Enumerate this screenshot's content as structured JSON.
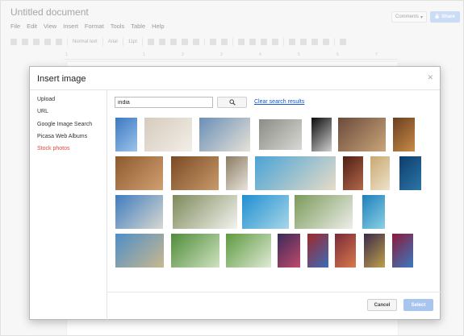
{
  "doc": {
    "title": "Untitled document",
    "menu": [
      "File",
      "Edit",
      "View",
      "Insert",
      "Format",
      "Tools",
      "Table",
      "Help"
    ],
    "comments_label": "Comments",
    "share_label": "Share",
    "toolbar": {
      "style": "Normal text",
      "font": "Arial",
      "size": "11pt"
    },
    "ruler_ticks": [
      "1",
      "1",
      "2",
      "3",
      "4",
      "5",
      "6",
      "7"
    ]
  },
  "dialog": {
    "title": "Insert image",
    "close_icon": "close-icon",
    "nav": [
      "Upload",
      "URL",
      "Google Image Search",
      "Picasa Web Albums",
      "Stock photos"
    ],
    "active_nav": "Stock photos",
    "active_color": "#dd4b39",
    "search_value": "india",
    "search_icon": "search-icon",
    "clear_label": "Clear search results",
    "cancel_label": "Cancel",
    "select_label": "Select",
    "accent": "#a8c5f0",
    "link_color": "#1155cc"
  },
  "thumbnails": [
    {
      "name": "blue-sky-water",
      "colors": [
        "#3b78c2",
        "#9cc4ea"
      ]
    },
    {
      "name": "white-room",
      "colors": [
        "#d6cbbd",
        "#f2eee8"
      ]
    },
    {
      "name": "taj-mahal",
      "colors": [
        "#6a8fb8",
        "#e6e1d6"
      ]
    },
    {
      "name": "elephant",
      "colors": [
        "#8c8c86",
        "#d8d8d4"
      ]
    },
    {
      "name": "arch-doorway",
      "colors": [
        "#0c0c0c",
        "#cfcfcf"
      ]
    },
    {
      "name": "colorful-market",
      "colors": [
        "#6b4a3a",
        "#c9a57a"
      ]
    },
    {
      "name": "spices",
      "colors": [
        "#6b3e20",
        "#c88b48"
      ]
    },
    {
      "name": "pottery-hands",
      "colors": [
        "#8d5a2f",
        "#d1a070"
      ]
    },
    {
      "name": "henna-hands",
      "colors": [
        "#7a4a24",
        "#c99a6a"
      ]
    },
    {
      "name": "buddha-head",
      "colors": [
        "#8b7b62",
        "#e8e4dc"
      ]
    },
    {
      "name": "beach-panorama",
      "colors": [
        "#4aa3d6",
        "#e6dcc8"
      ]
    },
    {
      "name": "woman-portrait",
      "colors": [
        "#4e1f14",
        "#b3684a"
      ]
    },
    {
      "name": "carved-statue",
      "colors": [
        "#c9a870",
        "#ede2cc"
      ]
    },
    {
      "name": "textile-pattern",
      "colors": [
        "#0c3d6b",
        "#2c76a8"
      ]
    },
    {
      "name": "taj-mahal-2",
      "colors": [
        "#3f7cbf",
        "#d8d8d0"
      ]
    },
    {
      "name": "palm-drawing",
      "colors": [
        "#7d8a5a",
        "#f3f3f0"
      ]
    },
    {
      "name": "tropical-beach",
      "colors": [
        "#1f8fd1",
        "#a9d6e8"
      ]
    },
    {
      "name": "toy-soldiers",
      "colors": [
        "#7a9a5a",
        "#eeeeea"
      ]
    },
    {
      "name": "blue-lagoon",
      "colors": [
        "#1d7fbb",
        "#8ad1e4"
      ]
    },
    {
      "name": "resort-pool",
      "colors": [
        "#4f8ec8",
        "#c8b88e"
      ]
    },
    {
      "name": "cricket-players",
      "colors": [
        "#4f8c3a",
        "#cfe2c0"
      ]
    },
    {
      "name": "cricket-batsman",
      "colors": [
        "#5d9a40",
        "#e0ead6"
      ]
    },
    {
      "name": "crowd-festival",
      "colors": [
        "#3a2a5a",
        "#c14a6a"
      ]
    },
    {
      "name": "colorful-fabric",
      "colors": [
        "#a0282a",
        "#3a6cb8"
      ]
    },
    {
      "name": "dancer",
      "colors": [
        "#7a2a3a",
        "#d87a4a"
      ]
    },
    {
      "name": "peacock-feathers",
      "colors": [
        "#3a2a4a",
        "#c0a04a"
      ]
    },
    {
      "name": "colored-threads",
      "colors": [
        "#8a1a3a",
        "#3a7ac0"
      ]
    }
  ]
}
